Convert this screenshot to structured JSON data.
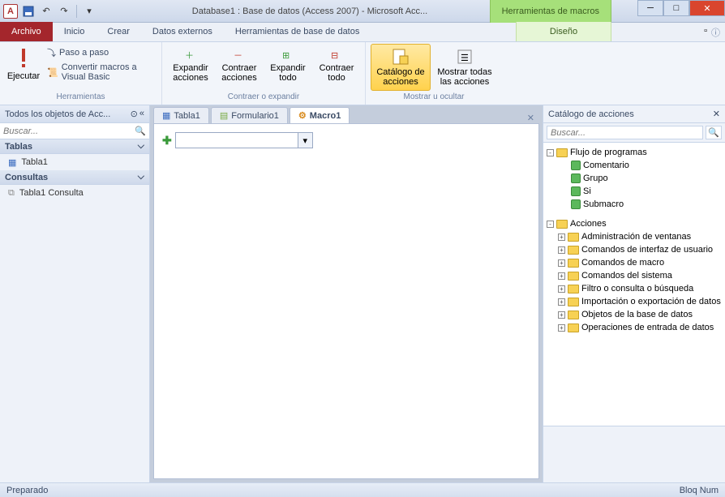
{
  "title": "Database1 : Base de datos (Access 2007)  -  Microsoft Acc...",
  "contextual_tab_group": "Herramientas de macros",
  "tabs": {
    "file": "Archivo",
    "home": "Inicio",
    "create": "Crear",
    "external": "Datos externos",
    "dbtools": "Herramientas de base de datos",
    "design": "Diseño"
  },
  "ribbon": {
    "run": "Ejecutar",
    "step": "Paso a paso",
    "convert": "Convertir macros a Visual Basic",
    "tools_label": "Herramientas",
    "expand_actions": "Expandir acciones",
    "collapse_actions": "Contraer acciones",
    "expand_all": "Expandir todo",
    "collapse_all": "Contraer todo",
    "collapse_label": "Contraer o expandir",
    "catalog": "Catálogo de acciones",
    "show_all": "Mostrar todas las acciones",
    "show_label": "Mostrar u ocultar"
  },
  "nav": {
    "title": "Todos los objetos de Acc...",
    "search_ph": "Buscar...",
    "tables": "Tablas",
    "table1": "Tabla1",
    "queries": "Consultas",
    "q1": "Tabla1 Consulta"
  },
  "doc_tabs": {
    "t1": "Tabla1",
    "f1": "Formulario1",
    "m1": "Macro1"
  },
  "catalog": {
    "title": "Catálogo de acciones",
    "search_ph": "Buscar...",
    "flow": "Flujo de programas",
    "comment": "Comentario",
    "group": "Grupo",
    "si": "Si",
    "submacro": "Submacro",
    "actions": "Acciones",
    "win_admin": "Administración de ventanas",
    "ui_cmds": "Comandos de interfaz de usuario",
    "macro_cmds": "Comandos de macro",
    "sys_cmds": "Comandos del sistema",
    "filter": "Filtro o consulta o búsqueda",
    "import": "Importación o exportación de datos",
    "db_obj": "Objetos de la base de datos",
    "data_ops": "Operaciones de entrada de datos"
  },
  "status": {
    "left": "Preparado",
    "right": "Bloq Num"
  }
}
